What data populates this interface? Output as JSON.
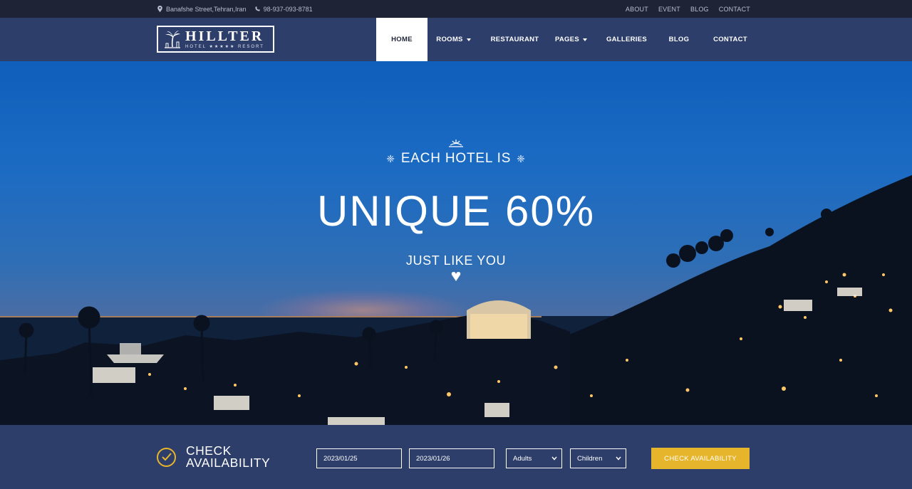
{
  "topbar": {
    "address": "Banafshe Street,Tehran,Iran",
    "phone": "98-937-093-8781",
    "links": [
      "ABOUT",
      "EVENT",
      "BLOG",
      "CONTACT"
    ]
  },
  "logo": {
    "name": "HILLTER",
    "tagline": "HOTEL ★★★★★ RESORT"
  },
  "nav": {
    "items": [
      {
        "label": "HOME",
        "active": true
      },
      {
        "label": "ROOMS",
        "dropdown": true
      },
      {
        "label": "RESTAURANT"
      },
      {
        "label": "PAGES",
        "dropdown": true
      },
      {
        "label": "GALLERIES"
      },
      {
        "label": "BLOG"
      },
      {
        "label": "CONTACT"
      }
    ]
  },
  "hero": {
    "eyebrow": "EACH HOTEL IS",
    "headline": "UNIQUE 60%",
    "subline": "JUST LIKE YOU"
  },
  "booking": {
    "title_line1": "CHECK",
    "title_line2": "AVAILABILITY",
    "checkin": "2023/01/25",
    "checkout": "2023/01/26",
    "adults": "Adults",
    "children": "Children",
    "button": "CHECK AVAILABILITY"
  },
  "colors": {
    "topbar": "#1e2436",
    "header": "#2e3e6a",
    "accent": "#e7b52b"
  }
}
